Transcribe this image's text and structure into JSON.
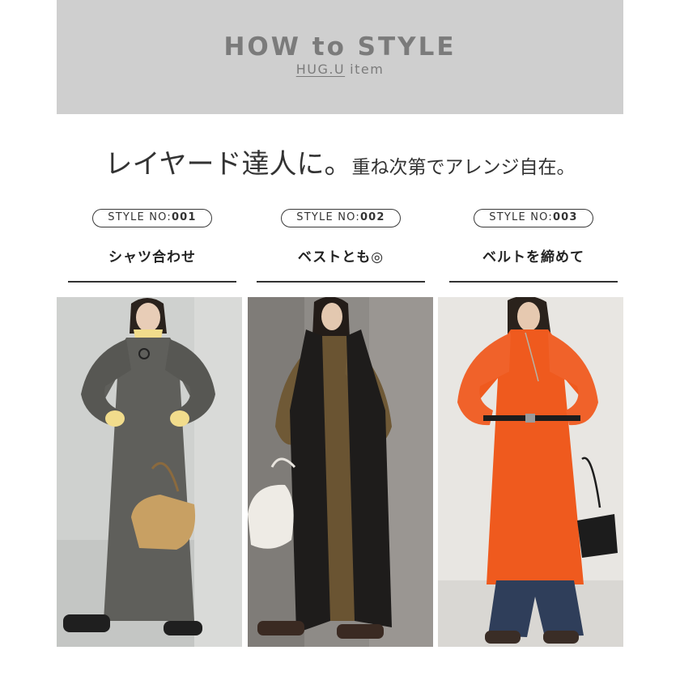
{
  "header": {
    "title": "HOW to STYLE",
    "brand": "HUG.U",
    "sub": "item"
  },
  "headline": {
    "main": "レイヤード達人に。",
    "sub": "重ね次第でアレンジ自在。"
  },
  "styles": [
    {
      "prefix": "STYLE NO:",
      "num": "001",
      "name": "シャツ合わせ",
      "dress_color": "#5f5f5b",
      "background": "#cdcfcd"
    },
    {
      "prefix": "STYLE NO:",
      "num": "002",
      "name": "ベストとも◎",
      "dress_color": "#6a5432",
      "background": "#8d8a86"
    },
    {
      "prefix": "STYLE NO:",
      "num": "003",
      "name": "ベルトを締めて",
      "dress_color": "#ef5a1e",
      "background": "#e9e7e3"
    }
  ]
}
